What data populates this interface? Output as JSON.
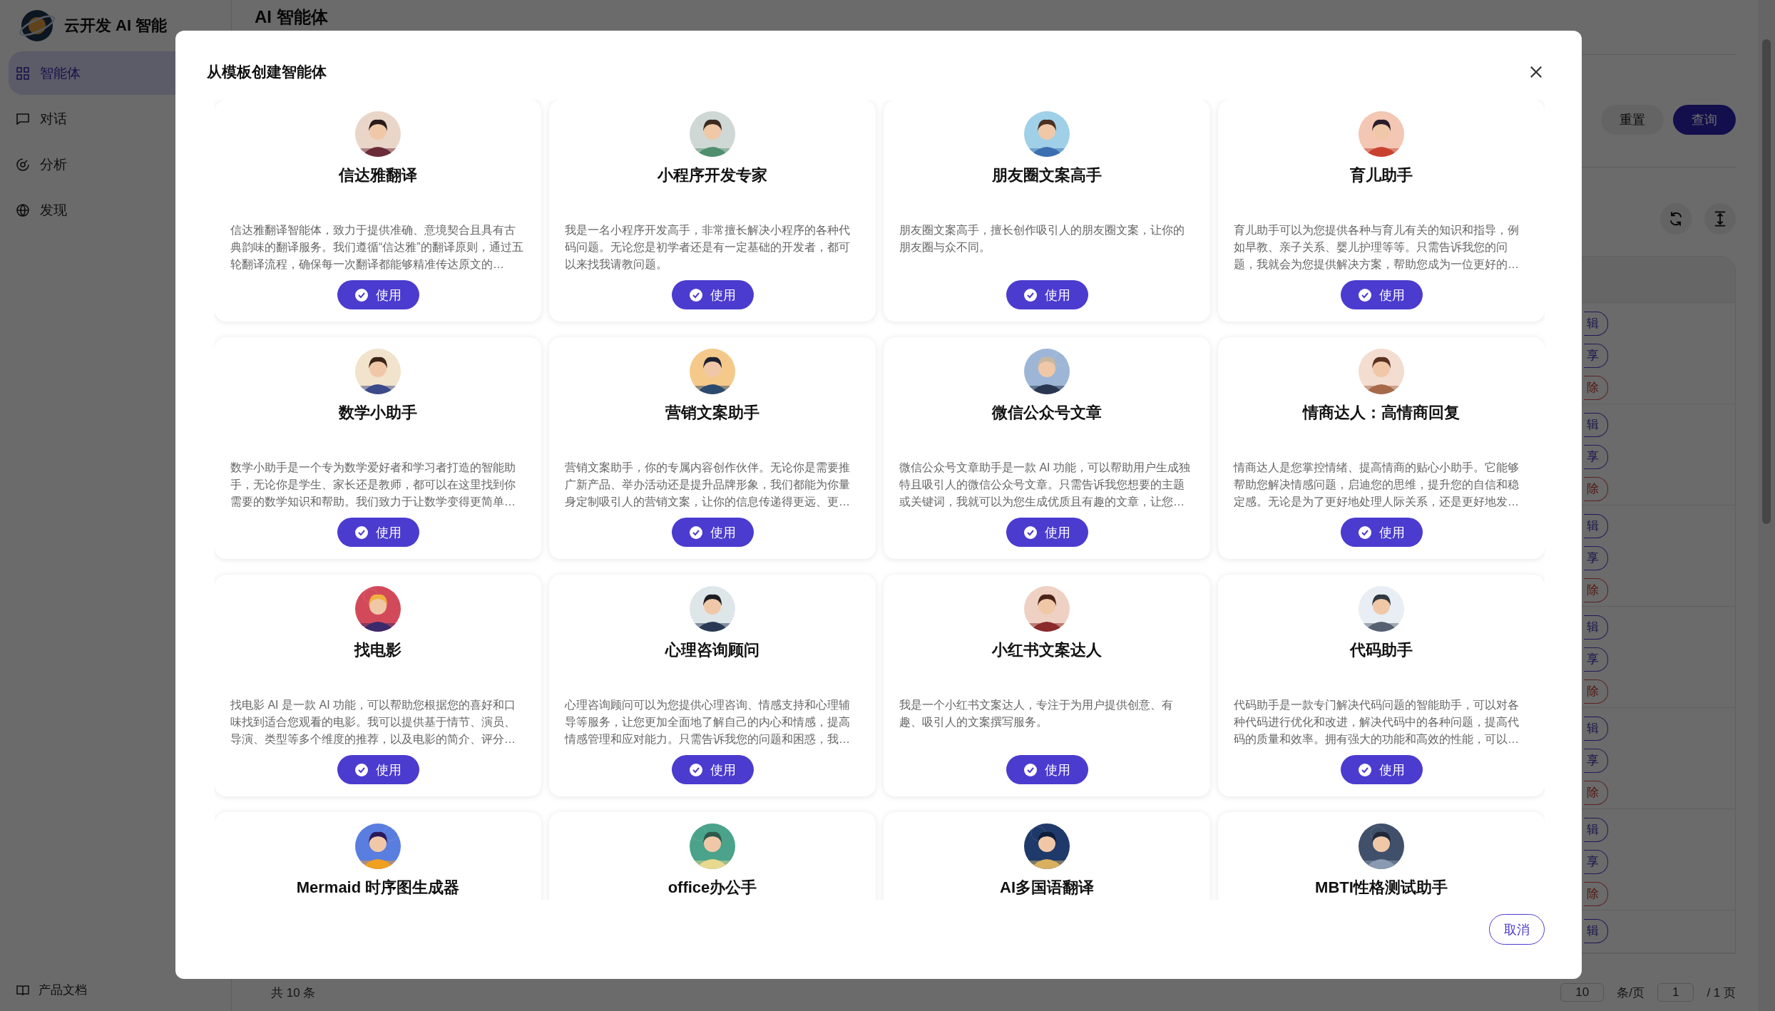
{
  "app": {
    "name": "云开发 AI 智能",
    "page_title": "AI 智能体"
  },
  "sidebar": {
    "items": [
      {
        "label": "智能体",
        "selected": true
      },
      {
        "label": "对话",
        "selected": false
      },
      {
        "label": "分析",
        "selected": false
      },
      {
        "label": "发现",
        "selected": false
      }
    ],
    "footer_link": "产品文档"
  },
  "toolbar": {
    "buttons": [
      {
        "label": "重置",
        "kind": "secondary"
      },
      {
        "label": "查询",
        "kind": "primary"
      }
    ]
  },
  "table": {
    "rows": [
      {
        "actions": [
          {
            "label": "辑",
            "kind": "edit"
          },
          {
            "label": "享",
            "kind": "share"
          },
          {
            "label": "除",
            "kind": "delete"
          }
        ]
      },
      {
        "actions": [
          {
            "label": "辑",
            "kind": "edit"
          },
          {
            "label": "享",
            "kind": "share"
          },
          {
            "label": "除",
            "kind": "delete"
          }
        ]
      },
      {
        "actions": [
          {
            "label": "辑",
            "kind": "edit"
          },
          {
            "label": "享",
            "kind": "share"
          },
          {
            "label": "除",
            "kind": "delete"
          }
        ]
      },
      {
        "actions": [
          {
            "label": "辑",
            "kind": "edit"
          },
          {
            "label": "享",
            "kind": "share"
          },
          {
            "label": "除",
            "kind": "delete"
          }
        ]
      },
      {
        "actions": [
          {
            "label": "辑",
            "kind": "edit"
          },
          {
            "label": "享",
            "kind": "share"
          },
          {
            "label": "除",
            "kind": "delete"
          }
        ]
      },
      {
        "actions": [
          {
            "label": "辑",
            "kind": "edit"
          },
          {
            "label": "享",
            "kind": "share"
          },
          {
            "label": "除",
            "kind": "delete"
          }
        ]
      },
      {
        "actions": [
          {
            "label": "辑",
            "kind": "edit"
          }
        ]
      }
    ]
  },
  "pagination": {
    "total": "共 10 条",
    "page_size": "10",
    "page_size_unit": "条/页",
    "page": "1",
    "page_count": "/ 1 页"
  },
  "modal": {
    "title": "从模板创建智能体",
    "cancel": "取消",
    "templates": [
      {
        "name": "信达雅翻译",
        "description": "信达雅翻译智能体，致力于提供准确、意境契合且具有古典韵味的翻译服务。我们遵循“信达雅”的翻译原则，通过五轮翻译流程，确保每一次翻译都能够精准传达原文的…",
        "button": "使用"
      },
      {
        "name": "小程序开发专家",
        "description": "我是一名小程序开发高手，非常擅长解决小程序的各种代码问题。无论您是初学者还是有一定基础的开发者，都可以来找我请教问题。",
        "button": "使用"
      },
      {
        "name": "朋友圈文案高手",
        "description": "朋友圈文案高手，擅长创作吸引人的朋友圈文案，让你的朋友圈与众不同。",
        "button": "使用"
      },
      {
        "name": "育儿助手",
        "description": "育儿助手可以为您提供各种与育儿有关的知识和指导，例如早教、亲子关系、婴儿护理等等。只需告诉我您的问题，我就会为您提供解决方案，帮助您成为一位更好的…",
        "button": "使用"
      },
      {
        "name": "数学小助手",
        "description": "数学小助手是一个专为数学爱好者和学习者打造的智能助手，无论你是学生、家长还是教师，都可以在这里找到你需要的数学知识和帮助。我们致力于让数学变得更简单…",
        "button": "使用"
      },
      {
        "name": "营销文案助手",
        "description": "营销文案助手，你的专属内容创作伙伴。无论你是需要推广新产品、举办活动还是提升品牌形象，我们都能为你量身定制吸引人的营销文案，让你的信息传递得更远、更…",
        "button": "使用"
      },
      {
        "name": "微信公众号文章",
        "description": "微信公众号文章助手是一款 AI 功能，可以帮助用户生成独特且吸引人的微信公众号文章。只需告诉我您想要的主题或关键词，我就可以为您生成优质且有趣的文章，让您…",
        "button": "使用"
      },
      {
        "name": "情商达人：高情商回复",
        "description": "情商达人是您掌控情绪、提高情商的贴心小助手。它能够帮助您解决情感问题，启迪您的思维，提升您的自信和稳定感。无论是为了更好地处理人际关系，还是更好地发…",
        "button": "使用"
      },
      {
        "name": "找电影",
        "description": "找电影 AI 是一款 AI 功能，可以帮助您根据您的喜好和口味找到适合您观看的电影。我可以提供基于情节、演员、导演、类型等多个维度的推荐，以及电影的简介、评分…",
        "button": "使用"
      },
      {
        "name": "心理咨询顾问",
        "description": "心理咨询顾问可以为您提供心理咨询、情感支持和心理辅导等服务，让您更加全面地了解自己的内心和情感，提高情感管理和应对能力。只需告诉我您的问题和困惑，我…",
        "button": "使用"
      },
      {
        "name": "小红书文案达人",
        "description": "我是一个小红书文案达人，专注于为用户提供创意、有趣、吸引人的文案撰写服务。",
        "button": "使用"
      },
      {
        "name": "代码助手",
        "description": "代码助手是一款专门解决代码问题的智能助手，可以对各种代码进行优化和改进，解决代码中的各种问题，提高代码的质量和效率。拥有强大的功能和高效的性能，可以…",
        "button": "使用"
      },
      {
        "name": "Mermaid 时序图生成器"
      },
      {
        "name": "office办公手"
      },
      {
        "name": "AI多国语翻译"
      },
      {
        "name": "MBTI性格测试助手"
      }
    ]
  }
}
